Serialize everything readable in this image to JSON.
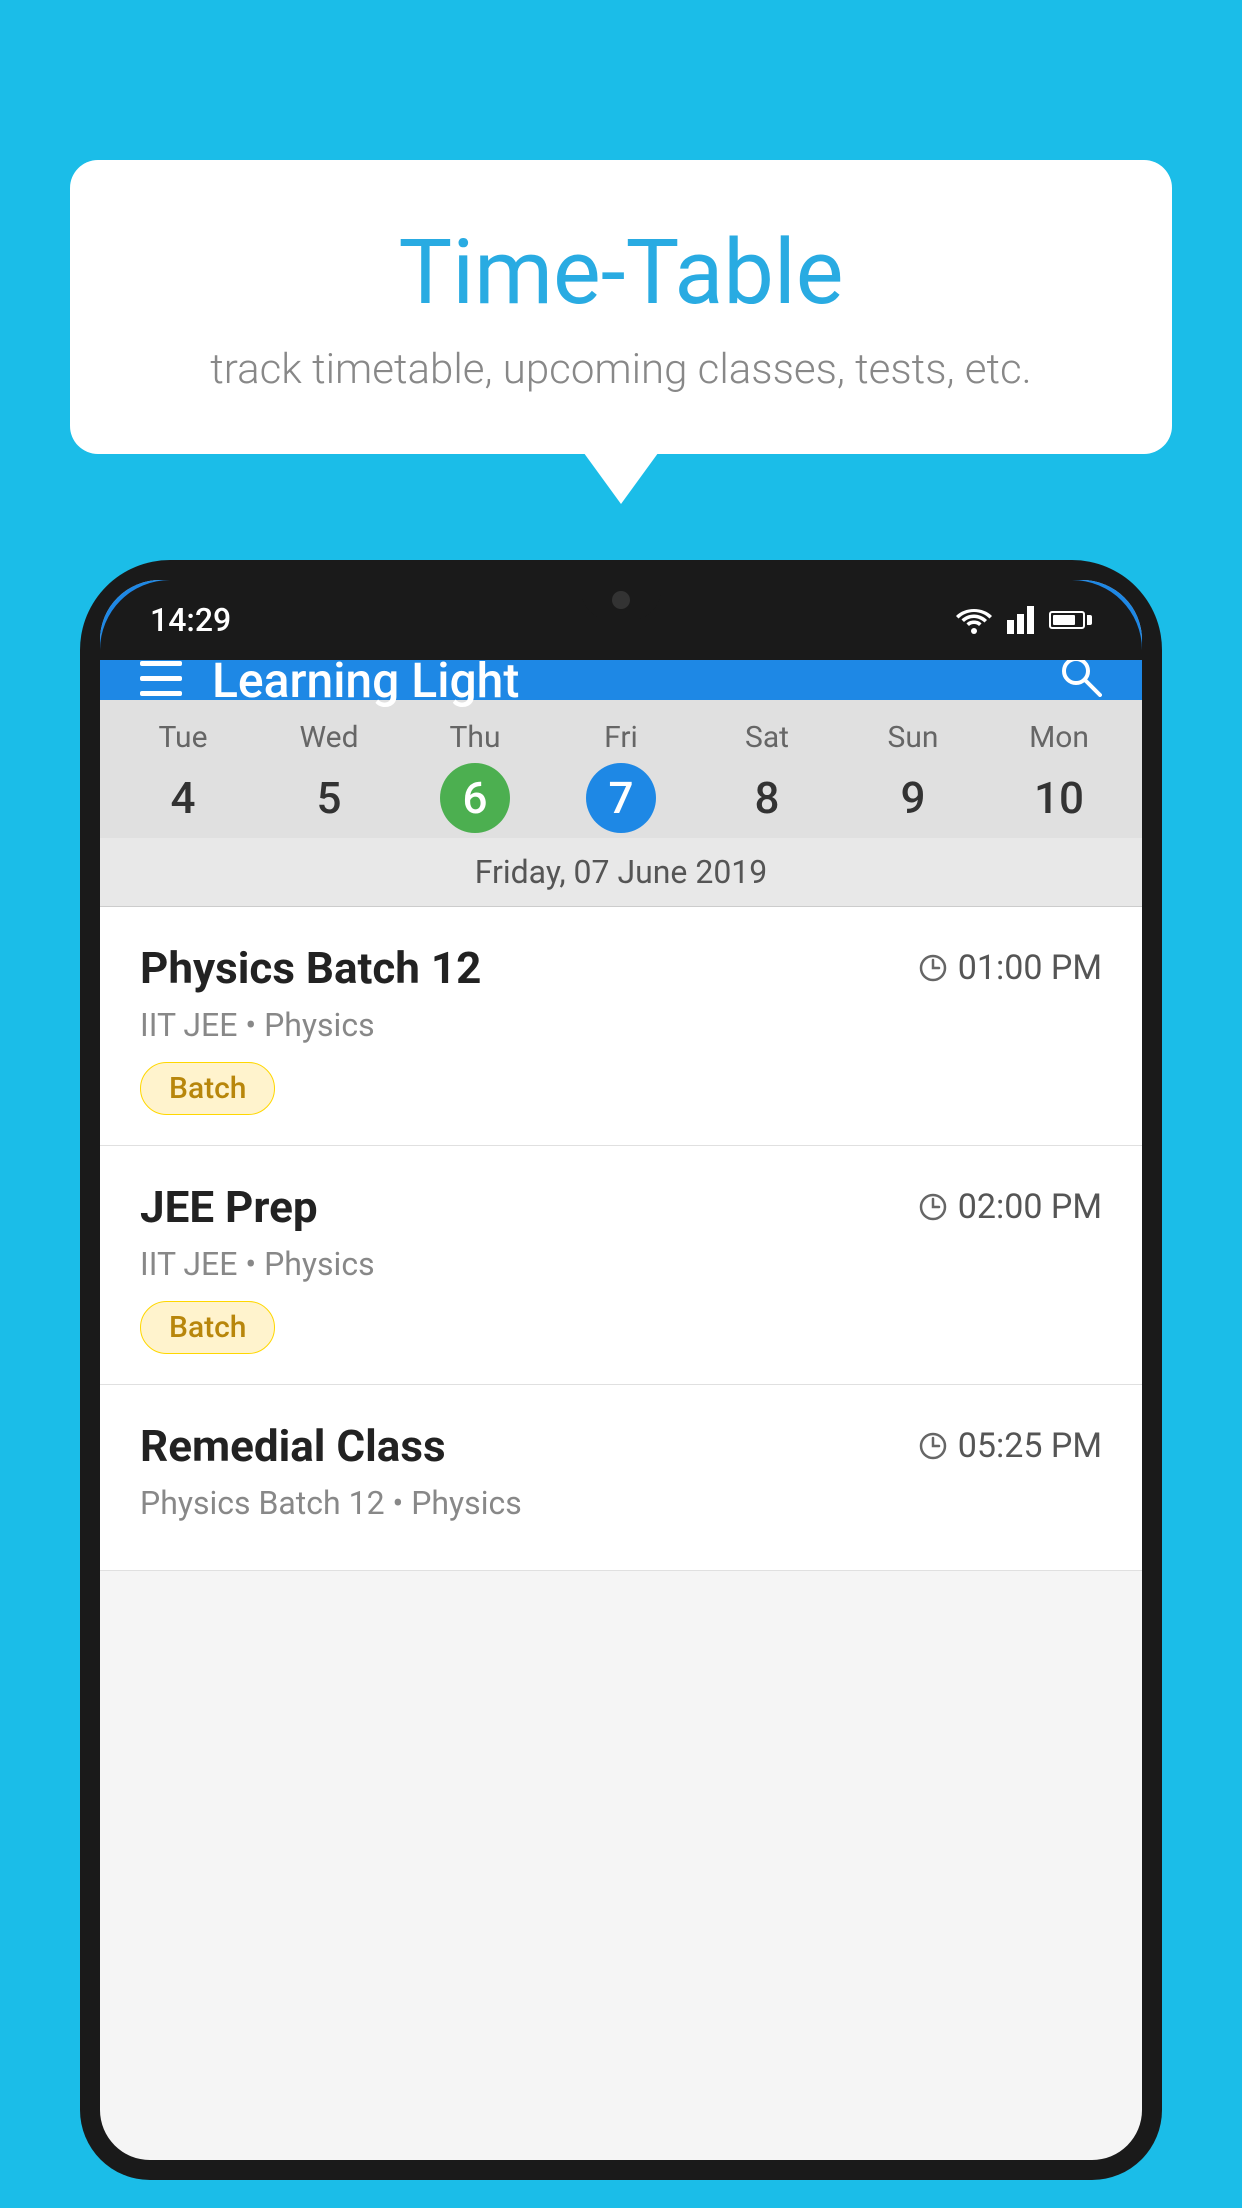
{
  "background_color": "#1BBDE8",
  "bubble": {
    "title": "Time-Table",
    "subtitle": "track timetable, upcoming classes, tests, etc."
  },
  "phone": {
    "status_bar": {
      "time": "14:29"
    },
    "app_bar": {
      "title": "Learning Light"
    },
    "calendar": {
      "days": [
        {
          "name": "Tue",
          "num": "4",
          "state": "normal"
        },
        {
          "name": "Wed",
          "num": "5",
          "state": "normal"
        },
        {
          "name": "Thu",
          "num": "6",
          "state": "today"
        },
        {
          "name": "Fri",
          "num": "7",
          "state": "selected"
        },
        {
          "name": "Sat",
          "num": "8",
          "state": "normal"
        },
        {
          "name": "Sun",
          "num": "9",
          "state": "normal"
        },
        {
          "name": "Mon",
          "num": "10",
          "state": "normal"
        }
      ],
      "selected_date_label": "Friday, 07 June 2019"
    },
    "classes": [
      {
        "name": "Physics Batch 12",
        "time": "01:00 PM",
        "meta": "IIT JEE • Physics",
        "badge": "Batch"
      },
      {
        "name": "JEE Prep",
        "time": "02:00 PM",
        "meta": "IIT JEE • Physics",
        "badge": "Batch"
      },
      {
        "name": "Remedial Class",
        "time": "05:25 PM",
        "meta": "Physics Batch 12 • Physics",
        "badge": null
      }
    ]
  }
}
